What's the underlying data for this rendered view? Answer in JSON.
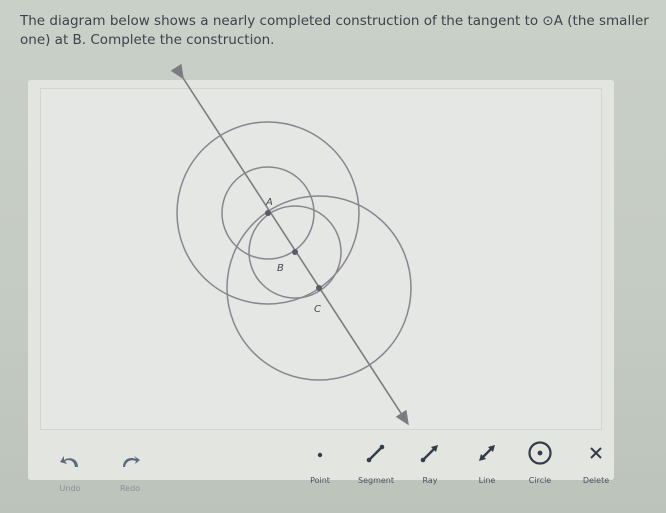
{
  "prompt": {
    "line1": "The diagram below shows a nearly completed construction of the tangent to ⊙A (the smaller",
    "line2": "one) at B. Complete the construction."
  },
  "diagram": {
    "points": {
      "A": "A",
      "B": "B",
      "C": "C"
    }
  },
  "toolbar": {
    "undo": "Undo",
    "redo": "Redo",
    "point": "Point",
    "segment": "Segment",
    "ray": "Ray",
    "line": "Line",
    "circle": "Circle",
    "delete": "Delete"
  },
  "colors": {
    "stroke": "#7d7a82",
    "point": "#5c5a62",
    "circle_tool_bg": "#2f3a4a"
  }
}
